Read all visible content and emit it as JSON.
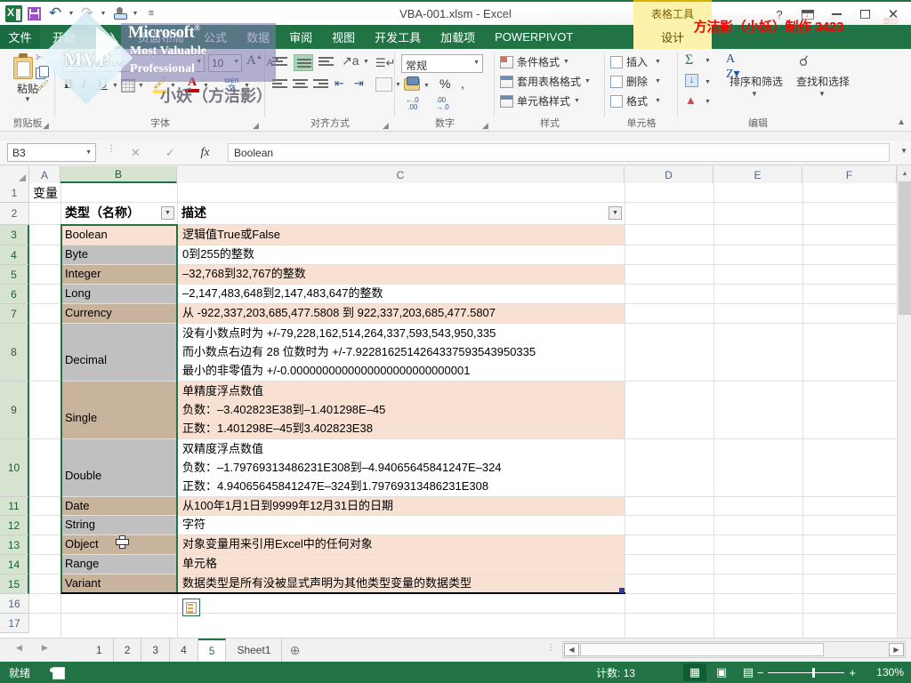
{
  "window": {
    "title": "VBA-001.xlsm - Excel",
    "quick_access": [
      {
        "name": "excel-logo",
        "label": ""
      },
      {
        "name": "save-icon",
        "label": ""
      },
      {
        "name": "undo-icon",
        "label": ""
      },
      {
        "name": "redo-icon",
        "label": ""
      },
      {
        "name": "touch-mode-icon",
        "label": ""
      },
      {
        "name": "customize-qat-icon",
        "label": ""
      }
    ],
    "controls": {
      "help": "?",
      "ribbon_display": "",
      "minimize": "",
      "maximize": "",
      "close": "✕"
    },
    "account_name": "方洁影（小妖）",
    "watermark_red": "方洁影（小妖）制作 3423"
  },
  "ribbon": {
    "tabs": [
      "文件",
      "开始",
      "插入",
      "页面布局",
      "公式",
      "数据",
      "审阅",
      "视图",
      "开发工具",
      "加载项",
      "POWERPIVOT"
    ],
    "active_tab": "开始",
    "contextual": {
      "group": "表格工具",
      "tab": "设计"
    },
    "groups": {
      "clipboard": {
        "label": "剪贴板",
        "paste": "粘贴",
        "items": [
          "剪切",
          "复制",
          "格式刷"
        ]
      },
      "font": {
        "label": "字体",
        "font_name": "Arial Narrow",
        "font_size": "10",
        "grow": "A",
        "shrink": "A",
        "bold": "B",
        "italic": "I",
        "underline": "U",
        "borders": "边框",
        "fill_color": "填充颜色",
        "font_color": "A",
        "phonetic": "wén"
      },
      "alignment": {
        "label": "对齐方式",
        "wrap": "自动换行",
        "merge": "合并后居中"
      },
      "number": {
        "label": "数字",
        "format": "常规",
        "percent": "%",
        "comma": ",",
        "increase_decimal": ".00",
        "decrease_decimal": ".00"
      },
      "styles": {
        "label": "样式",
        "items": [
          "条件格式",
          "套用表格格式",
          "单元格样式"
        ]
      },
      "cells": {
        "label": "单元格",
        "items": [
          "插入",
          "删除",
          "格式"
        ]
      },
      "editing": {
        "label": "编辑",
        "autosum": "Σ",
        "fill": "填充",
        "clear": "清除",
        "sort_filter": "排序和筛选",
        "find_select": "查找和选择"
      }
    },
    "watermark": {
      "line1": "Microsoft",
      "line2": "Most Valuable",
      "line3": "Professional",
      "badge": "MVP",
      "name": "小妖（方洁影）"
    }
  },
  "formula_bar": {
    "name_box": "B3",
    "cancel": "✕",
    "confirm": "✓",
    "fx": "fx",
    "content": "Boolean"
  },
  "grid": {
    "columns": [
      "A",
      "B",
      "C",
      "D",
      "E",
      "F"
    ],
    "selected_column": "B",
    "rows": [
      "1",
      "2",
      "3",
      "4",
      "5",
      "6",
      "7",
      "8",
      "9",
      "10",
      "11",
      "12",
      "13",
      "14",
      "15",
      "16",
      "17"
    ],
    "selected_rows": [
      "3",
      "4",
      "5",
      "6",
      "7",
      "8",
      "9",
      "10",
      "11",
      "12",
      "13",
      "14",
      "15"
    ],
    "a1_value": "变量",
    "table_header": {
      "type": "类型（名称）",
      "desc": "描述"
    },
    "table_rows": [
      {
        "row": "3",
        "type": "Boolean",
        "desc": [
          "逻辑值True或False"
        ]
      },
      {
        "row": "4",
        "type": "Byte",
        "desc": [
          "0到255的整数"
        ]
      },
      {
        "row": "5",
        "type": "Integer",
        "desc": [
          "–32,768到32,767的整数"
        ]
      },
      {
        "row": "6",
        "type": "Long",
        "desc": [
          "–2,147,483,648到2,147,483,647的整数"
        ]
      },
      {
        "row": "7",
        "type": "Currency",
        "desc": [
          "从 -922,337,203,685,477.5808 到 922,337,203,685,477.5807"
        ]
      },
      {
        "row": "8",
        "type": "Decimal",
        "desc": [
          "没有小数点时为 +/-79,228,162,514,264,337,593,543,950,335",
          "而小数点右边有 28 位数时为 +/-7.9228162514264337593543950335",
          "最小的非零值为 +/-0.0000000000000000000000000001"
        ]
      },
      {
        "row": "9",
        "type": "Single",
        "desc": [
          "单精度浮点数值",
          "负数：–3.402823E38到–1.401298E–45",
          "正数：1.401298E–45到3.402823E38"
        ]
      },
      {
        "row": "10",
        "type": "Double",
        "desc": [
          "双精度浮点数值",
          "负数：–1.79769313486231E308到–4.94065645841247E–324",
          "正数：4.94065645841247E–324到1.79769313486231E308"
        ]
      },
      {
        "row": "11",
        "type": "Date",
        "desc": [
          "从100年1月1日到9999年12月31日的日期"
        ]
      },
      {
        "row": "12",
        "type": "String",
        "desc": [
          "字符"
        ]
      },
      {
        "row": "13",
        "type": "Object",
        "desc": [
          "对象变量用来引用Excel中的任何对象"
        ]
      },
      {
        "row": "14",
        "type": "Range",
        "desc": [
          "单元格"
        ]
      },
      {
        "row": "15",
        "type": "Variant",
        "desc": [
          "数据类型是所有没被显式声明为其他类型变量的数据类型"
        ]
      }
    ],
    "paste_options_label": "粘贴选项"
  },
  "sheet_tabs": {
    "tabs": [
      "1",
      "2",
      "3",
      "4",
      "5",
      "Sheet1"
    ],
    "active": "5",
    "add_label": "⊕"
  },
  "status_bar": {
    "ready": "就绪",
    "macro_record": "录制宏",
    "count": "计数: 13",
    "views": [
      "普通",
      "页面布局",
      "分页预览"
    ],
    "zoom_out": "−",
    "zoom_in": "+",
    "zoom": "130%"
  },
  "colors": {
    "accent": "#217346",
    "header_band": "#d6e3d1",
    "table_band_light": "#f8e0d2",
    "table_band_mid": "#c8b49c",
    "table_band_gray": "#c0c0c0",
    "contextual": "#fdf2ab",
    "red_stamp": "#ff0000"
  }
}
